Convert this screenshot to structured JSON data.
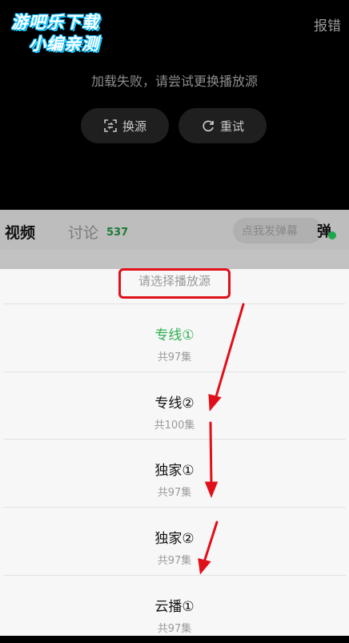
{
  "watermark": {
    "line1": "游吧乐下载",
    "line2": "小编亲测"
  },
  "player": {
    "report_label": "报错",
    "error_message": "加载失败，请尝试更换播放源",
    "switch_source_label": "换源",
    "retry_label": "重试"
  },
  "tabs": {
    "video_label": "视频",
    "comment_label": "讨论",
    "comment_count": "537",
    "danmaku_placeholder": "点我发弹幕",
    "danmaku_toggle_label": "弹"
  },
  "source_sheet": {
    "title": "请选择播放源",
    "options": [
      {
        "name": "专线①",
        "count": "共97集",
        "selected": true
      },
      {
        "name": "专线②",
        "count": "共100集",
        "selected": false
      },
      {
        "name": "独家①",
        "count": "共97集",
        "selected": false
      },
      {
        "name": "独家②",
        "count": "共97集",
        "selected": false
      },
      {
        "name": "云播①",
        "count": "共97集",
        "selected": false
      }
    ]
  },
  "colors": {
    "selected_option": "#2fae4f",
    "annotation_red": "#e0101a",
    "watermark_outline": "#19c4ff"
  }
}
